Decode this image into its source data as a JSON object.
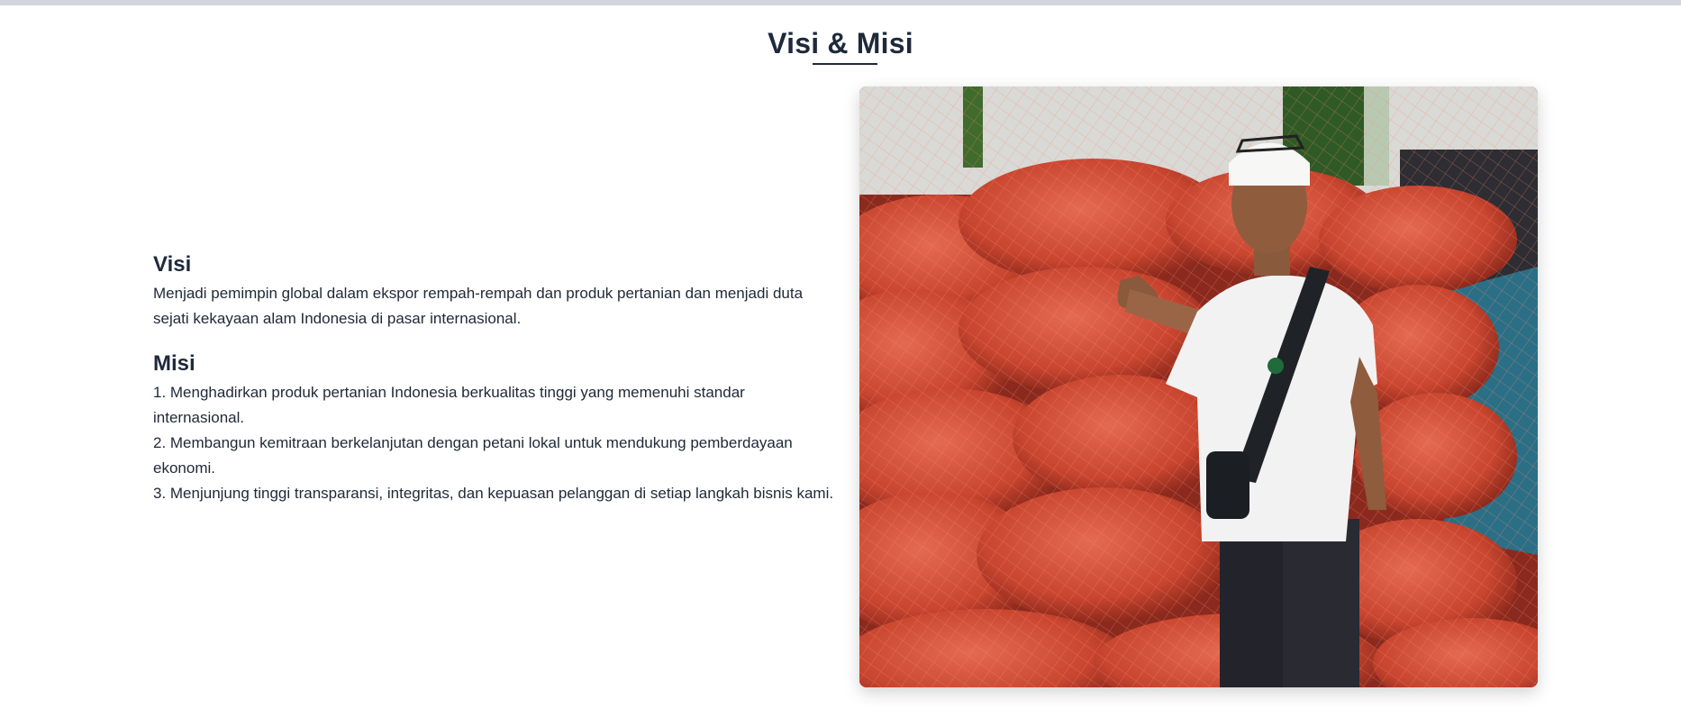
{
  "section": {
    "title": "Visi & Misi"
  },
  "visi": {
    "heading": "Visi",
    "text": "Menjadi pemimpin global dalam ekspor rempah-rempah dan produk pertanian dan menjadi duta sejati kekayaan alam Indonesia di pasar internasional."
  },
  "misi": {
    "heading": "Misi",
    "items": [
      "1. Menghadirkan produk pertanian Indonesia berkualitas tinggi yang memenuhi standar internasional.",
      "2. Membangun kemitraan berkelanjutan dengan petani lokal untuk mendukung pemberdayaan ekonomi.",
      "3. Menjunjung tinggi transparansi, integritas, dan kepuasan pelanggan di setiap langkah bisnis kami."
    ]
  },
  "colors": {
    "heading": "#1e293b",
    "body_text": "#1f2937",
    "top_strip": "#d1d5db"
  }
}
